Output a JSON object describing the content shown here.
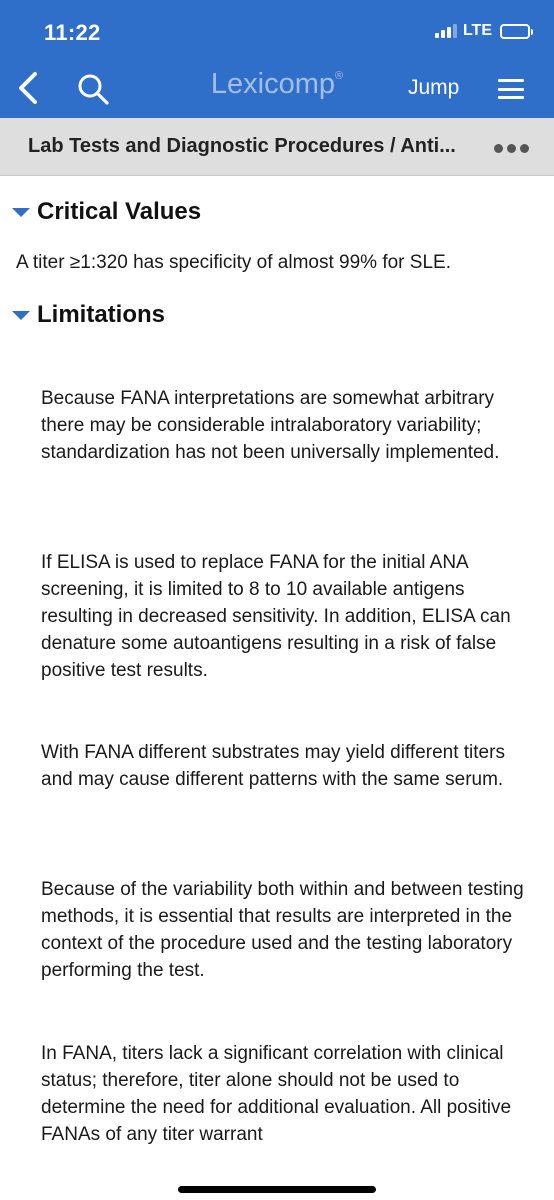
{
  "status_bar": {
    "time": "11:22",
    "network": "LTE"
  },
  "header": {
    "brand": "Lexicomp",
    "brand_mark": "®",
    "jump_label": "Jump"
  },
  "breadcrumb": {
    "text": "Lab Tests and Diagnostic Procedures / Anti..."
  },
  "sections": {
    "critical": {
      "title": "Critical Values",
      "text": "A titer ≥1:320 has specificity of almost 99% for SLE."
    },
    "limitations": {
      "title": "Limitations",
      "paragraphs": [
        "Because FANA interpretations are somewhat arbitrary there may be considerable intralaboratory variability; standardization has not been universally implemented.",
        "If ELISA is used to replace FANA for the initial ANA screening, it is limited to 8 to 10 available antigens resulting in decreased sensitivity. In addition, ELISA can denature some autoantigens resulting in a risk of false positive test results.",
        "With FANA different substrates may yield different titers and may cause different patterns with the same serum.",
        "Because of the variability both within and between testing methods, it is essential that results are interpreted in the context of the procedure used and the testing laboratory performing the test.",
        "In FANA, titers lack a significant correlation with clinical status; therefore, titer alone should not be used to determine the need for additional evaluation. All positive FANAs of any titer warrant"
      ]
    }
  },
  "colors": {
    "accent": "#2f6fc9",
    "breadcrumb_bg": "#dedede"
  },
  "icons": [
    "back-chevron-icon",
    "search-icon",
    "menu-icon",
    "more-options-icon",
    "signal-icon",
    "battery-icon"
  ]
}
